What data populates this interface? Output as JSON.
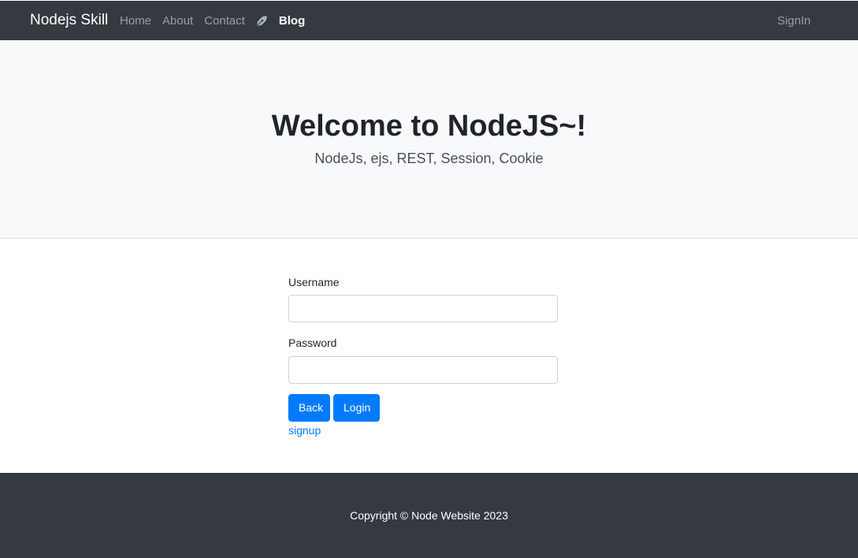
{
  "navbar": {
    "brand": "Nodejs Skill",
    "links": [
      {
        "label": "Home"
      },
      {
        "label": "About"
      },
      {
        "label": "Contact"
      },
      {
        "label": "Blog",
        "icon": "pen-icon"
      }
    ],
    "signin": "SignIn"
  },
  "jumbotron": {
    "title": "Welcome to NodeJS~!",
    "subtitle": "NodeJs, ejs, REST, Session, Cookie"
  },
  "form": {
    "username_label": "Username",
    "username_value": "",
    "password_label": "Password",
    "password_value": "",
    "back_label": "Back",
    "login_label": "Login",
    "signup_label": "signup"
  },
  "footer": {
    "copyright": "Copyright © Node Website 2023"
  },
  "colors": {
    "navbar_bg": "#343a40",
    "jumbotron_bg": "#f8f9fa",
    "primary": "#007bff",
    "footer_bg": "#343a40"
  }
}
